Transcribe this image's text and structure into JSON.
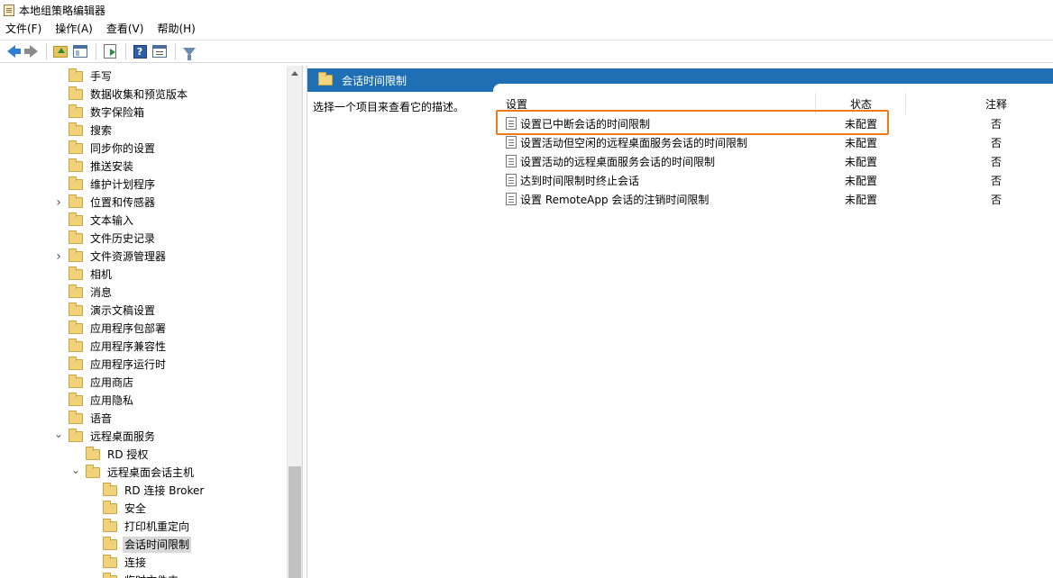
{
  "window": {
    "title": "本地组策略编辑器"
  },
  "menu": [
    "文件(F)",
    "操作(A)",
    "查看(V)",
    "帮助(H)"
  ],
  "toolbar": {
    "buttons": [
      "back-icon",
      "forward-icon",
      "up-folder-icon",
      "show-hide-tree-icon",
      "export-list-icon",
      "help-icon",
      "properties-icon",
      "filter-icon"
    ]
  },
  "tree": {
    "items": [
      {
        "label": "手写",
        "level": 1,
        "expander": ""
      },
      {
        "label": "数据收集和预览版本",
        "level": 1,
        "expander": ""
      },
      {
        "label": "数字保险箱",
        "level": 1,
        "expander": ""
      },
      {
        "label": "搜索",
        "level": 1,
        "expander": ""
      },
      {
        "label": "同步你的设置",
        "level": 1,
        "expander": ""
      },
      {
        "label": "推送安装",
        "level": 1,
        "expander": ""
      },
      {
        "label": "维护计划程序",
        "level": 1,
        "expander": ""
      },
      {
        "label": "位置和传感器",
        "level": 1,
        "expander": "collapsed"
      },
      {
        "label": "文本输入",
        "level": 1,
        "expander": ""
      },
      {
        "label": "文件历史记录",
        "level": 1,
        "expander": ""
      },
      {
        "label": "文件资源管理器",
        "level": 1,
        "expander": "collapsed"
      },
      {
        "label": "相机",
        "level": 1,
        "expander": ""
      },
      {
        "label": "消息",
        "level": 1,
        "expander": ""
      },
      {
        "label": "演示文稿设置",
        "level": 1,
        "expander": ""
      },
      {
        "label": "应用程序包部署",
        "level": 1,
        "expander": ""
      },
      {
        "label": "应用程序兼容性",
        "level": 1,
        "expander": ""
      },
      {
        "label": "应用程序运行时",
        "level": 1,
        "expander": ""
      },
      {
        "label": "应用商店",
        "level": 1,
        "expander": ""
      },
      {
        "label": "应用隐私",
        "level": 1,
        "expander": ""
      },
      {
        "label": "语音",
        "level": 1,
        "expander": ""
      },
      {
        "label": "远程桌面服务",
        "level": 1,
        "expander": "expanded"
      },
      {
        "label": "RD 授权",
        "level": 2,
        "expander": ""
      },
      {
        "label": "远程桌面会话主机",
        "level": 2,
        "expander": "expanded"
      },
      {
        "label": "RD 连接 Broker",
        "level": 3,
        "expander": ""
      },
      {
        "label": "安全",
        "level": 3,
        "expander": ""
      },
      {
        "label": "打印机重定向",
        "level": 3,
        "expander": ""
      },
      {
        "label": "会话时间限制",
        "level": 3,
        "expander": "",
        "selected": true
      },
      {
        "label": "连接",
        "level": 3,
        "expander": ""
      },
      {
        "label": "临时文件夹",
        "level": 3,
        "expander": ""
      }
    ]
  },
  "right": {
    "header_title": "会话时间限制",
    "description": "选择一个项目来查看它的描述。",
    "columns": {
      "setting": "设置",
      "state": "状态",
      "comment": "注释"
    },
    "rows": [
      {
        "name": "设置已中断会话的时间限制",
        "state": "未配置",
        "comment": "否",
        "highlighted": true
      },
      {
        "name": "设置活动但空闲的远程桌面服务会话的时间限制",
        "state": "未配置",
        "comment": "否"
      },
      {
        "name": "设置活动的远程桌面服务会话的时间限制",
        "state": "未配置",
        "comment": "否"
      },
      {
        "name": "达到时间限制时终止会话",
        "state": "未配置",
        "comment": "否"
      },
      {
        "name": "设置 RemoteApp 会话的注销时间限制",
        "state": "未配置",
        "comment": "否"
      }
    ]
  },
  "colors": {
    "header_blue": "#1f6fb4",
    "highlight_orange": "#f07a1a",
    "selected_bg": "#d9d9d9"
  }
}
